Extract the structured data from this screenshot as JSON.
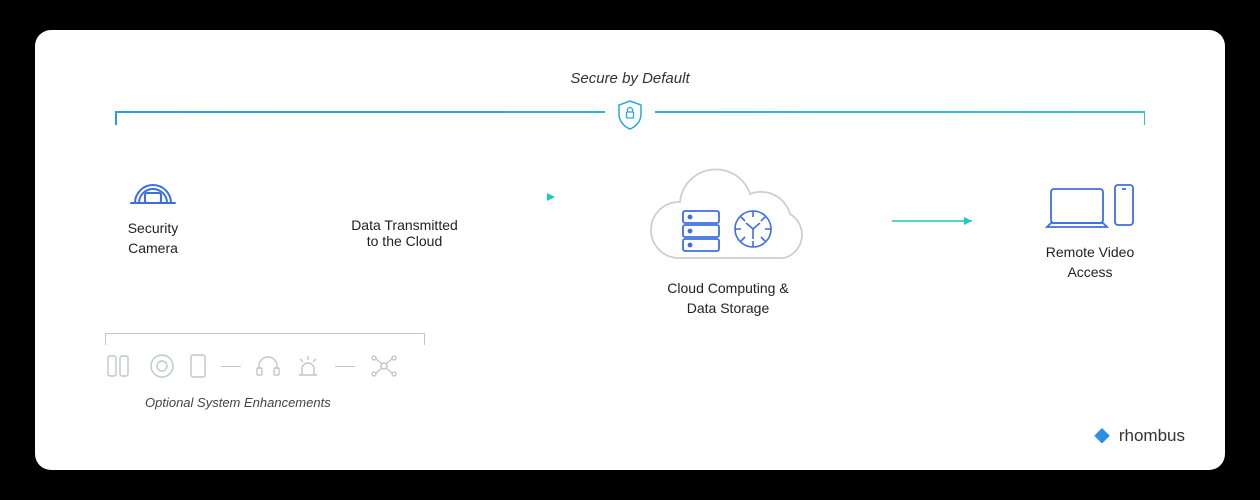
{
  "header": {
    "secure_label": "Secure by Default"
  },
  "nodes": {
    "camera": {
      "label": "Security\nCamera"
    },
    "transmit": {
      "label": "Data Transmitted\nto the Cloud"
    },
    "cloud": {
      "label": "Cloud Computing &\nData Storage"
    },
    "access": {
      "label": "Remote Video\nAccess"
    }
  },
  "enhancements": {
    "label": "Optional System Enhancements",
    "icons": [
      "door-sensor-icon",
      "motion-sensor-icon",
      "badge-icon",
      "headset-icon",
      "alarm-icon",
      "integration-icon"
    ]
  },
  "brand": {
    "name": "rhombus"
  }
}
